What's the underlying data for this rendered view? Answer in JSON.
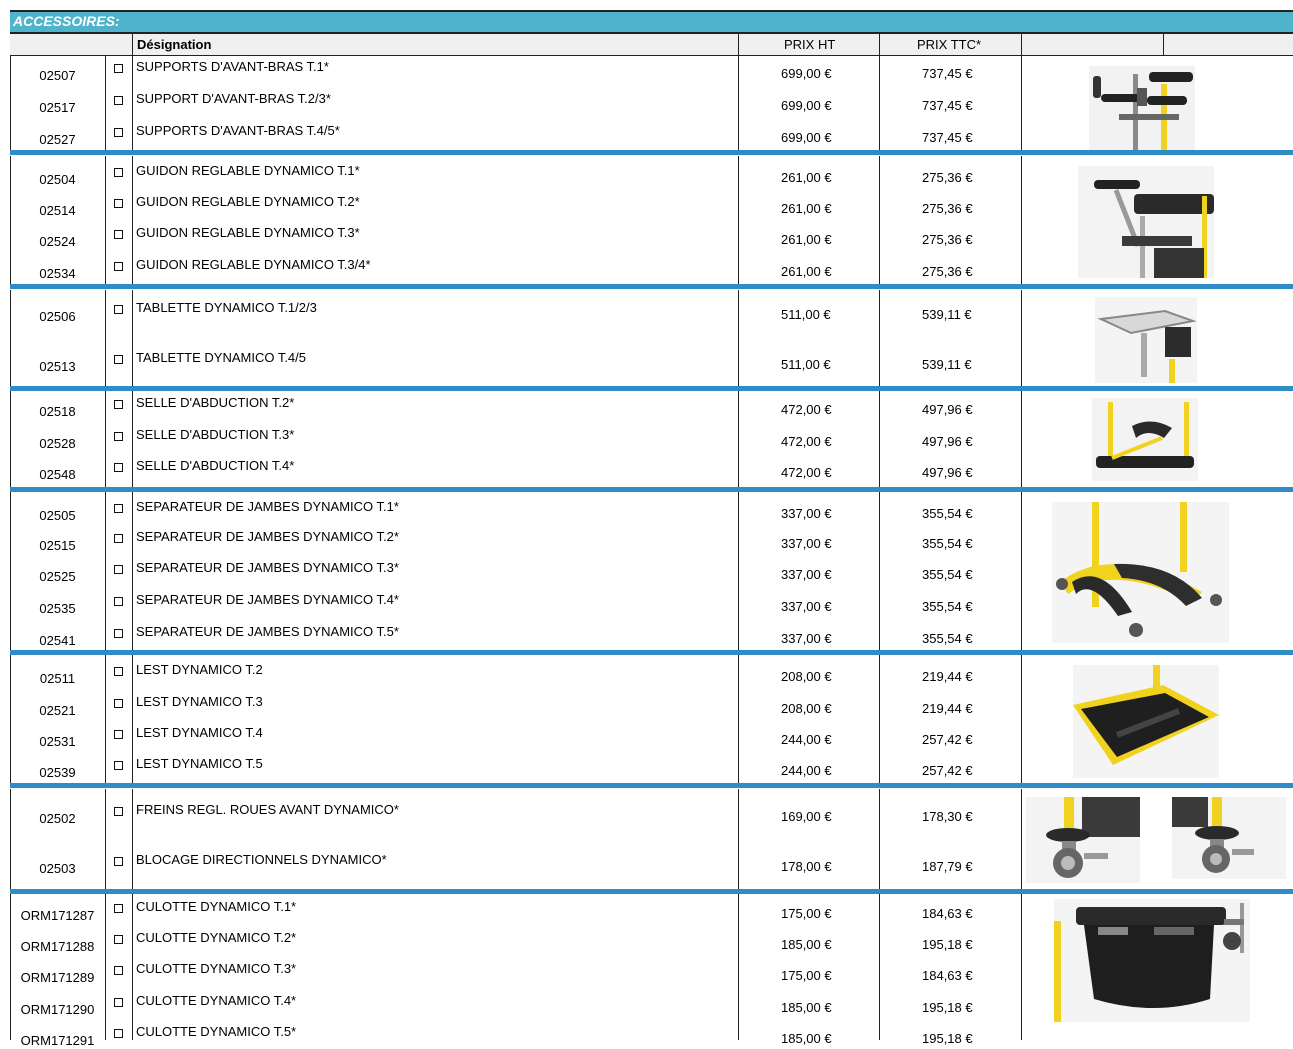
{
  "section_title": "ACCESSOIRES:",
  "headers": {
    "designation": "Désignation",
    "prix_ht": "PRIX HT",
    "prix_ttc": "PRIX TTC*"
  },
  "rows": [
    {
      "code": "02507",
      "label": "SUPPORTS D'AVANT-BRAS T.1*",
      "ht": "699,00 €",
      "ttc": "737,45 €"
    },
    {
      "code": "02517",
      "label": "SUPPORT D'AVANT-BRAS T.2/3*",
      "ht": "699,00 €",
      "ttc": "737,45 €"
    },
    {
      "code": "02527",
      "label": "SUPPORTS D'AVANT-BRAS T.4/5*",
      "ht": "699,00 €",
      "ttc": "737,45 €"
    },
    {
      "code": "02504",
      "label": "GUIDON REGLABLE DYNAMICO T.1*",
      "ht": "261,00 €",
      "ttc": "275,36 €"
    },
    {
      "code": "02514",
      "label": "GUIDON REGLABLE DYNAMICO T.2*",
      "ht": "261,00 €",
      "ttc": "275,36 €"
    },
    {
      "code": "02524",
      "label": "GUIDON REGLABLE DYNAMICO T.3*",
      "ht": "261,00 €",
      "ttc": "275,36 €"
    },
    {
      "code": "02534",
      "label": "GUIDON REGLABLE DYNAMICO T.3/4*",
      "ht": "261,00 €",
      "ttc": "275,36 €"
    },
    {
      "code": "02506",
      "label": "TABLETTE DYNAMICO T.1/2/3",
      "ht": "511,00 €",
      "ttc": "539,11 €"
    },
    {
      "code": "02513",
      "label": "TABLETTE DYNAMICO T.4/5",
      "ht": "511,00 €",
      "ttc": "539,11 €"
    },
    {
      "code": "02518",
      "label": "SELLE D'ABDUCTION T.2*",
      "ht": "472,00 €",
      "ttc": "497,96 €"
    },
    {
      "code": "02528",
      "label": "SELLE D'ABDUCTION T.3*",
      "ht": "472,00 €",
      "ttc": "497,96 €"
    },
    {
      "code": "02548",
      "label": "SELLE D'ABDUCTION T.4*",
      "ht": "472,00 €",
      "ttc": "497,96 €"
    },
    {
      "code": "02505",
      "label": "SEPARATEUR DE JAMBES DYNAMICO T.1*",
      "ht": "337,00 €",
      "ttc": "355,54 €"
    },
    {
      "code": "02515",
      "label": "SEPARATEUR DE JAMBES DYNAMICO T.2*",
      "ht": "337,00 €",
      "ttc": "355,54 €"
    },
    {
      "code": "02525",
      "label": "SEPARATEUR DE JAMBES DYNAMICO T.3*",
      "ht": "337,00 €",
      "ttc": "355,54 €"
    },
    {
      "code": "02535",
      "label": "SEPARATEUR DE JAMBES DYNAMICO T.4*",
      "ht": "337,00 €",
      "ttc": "355,54 €"
    },
    {
      "code": "02541",
      "label": "SEPARATEUR DE JAMBES DYNAMICO T.5*",
      "ht": "337,00 €",
      "ttc": "355,54 €"
    },
    {
      "code": "02511",
      "label": "LEST DYNAMICO T.2",
      "ht": "208,00 €",
      "ttc": "219,44 €"
    },
    {
      "code": "02521",
      "label": "LEST DYNAMICO T.3",
      "ht": "208,00 €",
      "ttc": "219,44 €"
    },
    {
      "code": "02531",
      "label": "LEST DYNAMICO T.4",
      "ht": "244,00 €",
      "ttc": "257,42 €"
    },
    {
      "code": "02539",
      "label": "LEST DYNAMICO T.5",
      "ht": "244,00 €",
      "ttc": "257,42 €"
    },
    {
      "code": "02502",
      "label": "FREINS REGL. ROUES AVANT DYNAMICO*",
      "ht": "169,00 €",
      "ttc": "178,30 €"
    },
    {
      "code": "02503",
      "label": "BLOCAGE DIRECTIONNELS DYNAMICO*",
      "ht": "178,00 €",
      "ttc": "187,79 €"
    },
    {
      "code": "ORM171287",
      "label": "CULOTTE DYNAMICO T.1*",
      "ht": "175,00 €",
      "ttc": "184,63 €"
    },
    {
      "code": "ORM171288",
      "label": "CULOTTE DYNAMICO T.2*",
      "ht": "185,00 €",
      "ttc": "195,18 €"
    },
    {
      "code": "ORM171289",
      "label": "CULOTTE DYNAMICO T.3*",
      "ht": "175,00 €",
      "ttc": "184,63 €"
    },
    {
      "code": "ORM171290",
      "label": "CULOTTE DYNAMICO T.4*",
      "ht": "185,00 €",
      "ttc": "195,18 €"
    },
    {
      "code": "ORM171291",
      "label": "CULOTTE DYNAMICO T.5*",
      "ht": "185,00 €",
      "ttc": "195,18 €"
    }
  ],
  "colors": {
    "banner": "#4fb3cc",
    "separator": "#2f8cc6",
    "accent_yellow": "#f1d21f"
  }
}
